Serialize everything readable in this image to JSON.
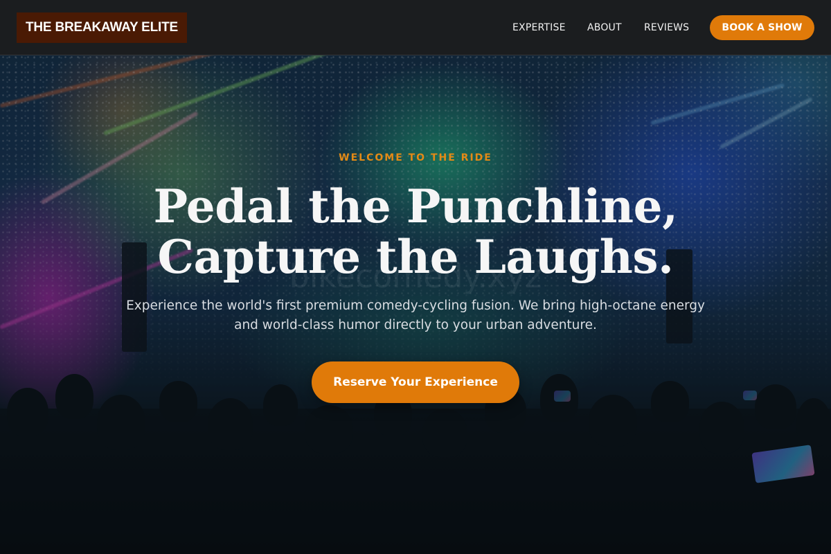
{
  "navbar": {
    "brand": "THE BREAKAWAY ELITE",
    "links": [
      {
        "label": "EXPERTISE"
      },
      {
        "label": "ABOUT"
      },
      {
        "label": "REVIEWS"
      }
    ],
    "cta_label": "BOOK A SHOW"
  },
  "hero": {
    "eyebrow": "WELCOME TO THE RIDE",
    "headline_line1": "Pedal the Punchline,",
    "headline_line2": "Capture the Laughs.",
    "watermark": "bikecomedy.xyz",
    "subtext": "Experience the world's first premium comedy-cycling fusion. We bring high-octane energy and world-class humor directly to your urban adventure.",
    "cta_label": "Reserve Your Experience",
    "background": "concert-crowd-stage-lights"
  },
  "colors": {
    "accent": "#e07a09",
    "brand_bg": "#4a1a04",
    "navbar_bg": "#1b1d1f",
    "eyebrow": "#e38a16"
  }
}
